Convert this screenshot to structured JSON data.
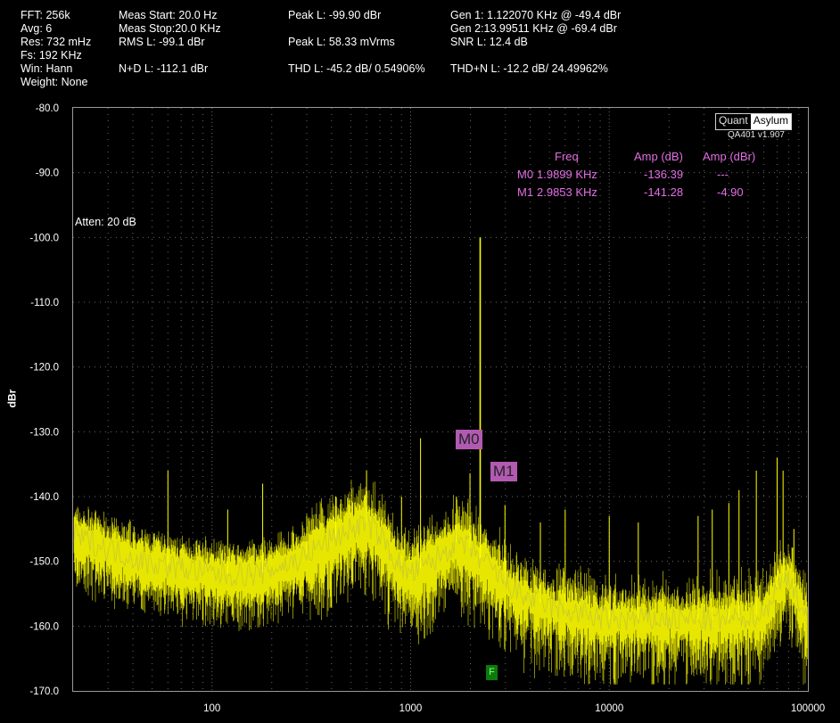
{
  "header": {
    "col1": [
      "FFT: 256k",
      "Avg: 6",
      "Res: 732 mHz",
      "Fs: 192 KHz",
      "Win: Hann",
      "Weight: None"
    ],
    "col2": [
      "Meas Start: 20.0 Hz",
      "Meas Stop:20.0 KHz",
      "RMS L: -99.1 dBr",
      "N+D L: -112.1 dBr"
    ],
    "col3": [
      "Peak L: -99.90 dBr",
      "Peak L: 58.33 mVrms",
      "THD L: -45.2 dB/ 0.54906%"
    ],
    "col4_gray": "Gen 1: 1.122070 KHz @ -49.4  dBr",
    "col4": [
      "Gen 2:13.99511 KHz @ -69.4  dBr",
      "SNR L: 12.4 dB",
      "THD+N L: -12.2 dB/ 24.49962%"
    ]
  },
  "logo": {
    "left": "Quant",
    "right": "Asylum",
    "version": "QA401 v1.907"
  },
  "annotation": "Atten: 20 dB",
  "markers_table": {
    "headers": [
      "Freq",
      "Amp (dB)",
      "Amp (dBr)"
    ],
    "rows": [
      {
        "name": "M0",
        "freq": "1.9899 KHz",
        "amp_db": "-136.39",
        "amp_dbr": "---"
      },
      {
        "name": "M1",
        "freq": "2.9853 KHz",
        "amp_db": "-141.28",
        "amp_dbr": "-4.90"
      }
    ]
  },
  "marker_labels": [
    "M0",
    "M1"
  ],
  "f_tag": "F",
  "colors": {
    "trace": "#ffff00",
    "trace_dim": "#c8c830",
    "marker": "#e36ee3",
    "grid": "#6a6a6a"
  },
  "chart_data": {
    "type": "line",
    "xscale": "log",
    "xlim": [
      20,
      100000
    ],
    "ylim": [
      -170,
      -80
    ],
    "ylabel": "dBr",
    "xticks": [
      100,
      1000,
      10000,
      100000
    ],
    "xtick_labels": [
      "100",
      "1000",
      "10000",
      "100000"
    ],
    "yticks": [
      -80,
      -90,
      -100,
      -110,
      -120,
      -130,
      -140,
      -150,
      -160,
      -170
    ],
    "ytick_labels": [
      "-80.0",
      "-90.0",
      "-100.0",
      "-110.0",
      "-120.0",
      "-130.0",
      "-140.0",
      "-150.0",
      "-160.0",
      "-170.0"
    ],
    "grid": true,
    "series": [
      {
        "floor": [
          [
            20,
            -146
          ],
          [
            30,
            -148
          ],
          [
            45,
            -150
          ],
          [
            70,
            -151
          ],
          [
            110,
            -152
          ],
          [
            170,
            -152
          ],
          [
            260,
            -150
          ],
          [
            380,
            -147
          ],
          [
            500,
            -145
          ],
          [
            600,
            -144
          ],
          [
            700,
            -146
          ],
          [
            850,
            -150
          ],
          [
            1000,
            -152
          ],
          [
            1300,
            -150
          ],
          [
            1700,
            -147
          ],
          [
            2000,
            -148
          ],
          [
            2500,
            -151
          ],
          [
            3500,
            -155
          ],
          [
            5000,
            -157
          ],
          [
            7000,
            -158
          ],
          [
            10000,
            -159
          ],
          [
            15000,
            -159
          ],
          [
            25000,
            -159
          ],
          [
            40000,
            -159
          ],
          [
            60000,
            -158
          ],
          [
            70000,
            -154
          ],
          [
            80000,
            -152
          ],
          [
            90000,
            -156
          ],
          [
            100000,
            -160
          ]
        ],
        "spikes": [
          [
            60,
            -136
          ],
          [
            120,
            -142
          ],
          [
            180,
            -138
          ],
          [
            300,
            -143
          ],
          [
            420,
            -140
          ],
          [
            600,
            -136
          ],
          [
            900,
            -140
          ],
          [
            1122,
            -131
          ],
          [
            1700,
            -140
          ],
          [
            1990,
            -136.4
          ],
          [
            2240,
            -100
          ],
          [
            2985,
            -141.3
          ],
          [
            4500,
            -144
          ],
          [
            6000,
            -142
          ],
          [
            10000,
            -143
          ],
          [
            14000,
            -144
          ],
          [
            28000,
            -143
          ],
          [
            33000,
            -142
          ],
          [
            40000,
            -141
          ],
          [
            45000,
            -139
          ],
          [
            55000,
            -136
          ],
          [
            70000,
            -134
          ],
          [
            75000,
            -136
          ],
          [
            85000,
            -145
          ]
        ]
      }
    ]
  }
}
